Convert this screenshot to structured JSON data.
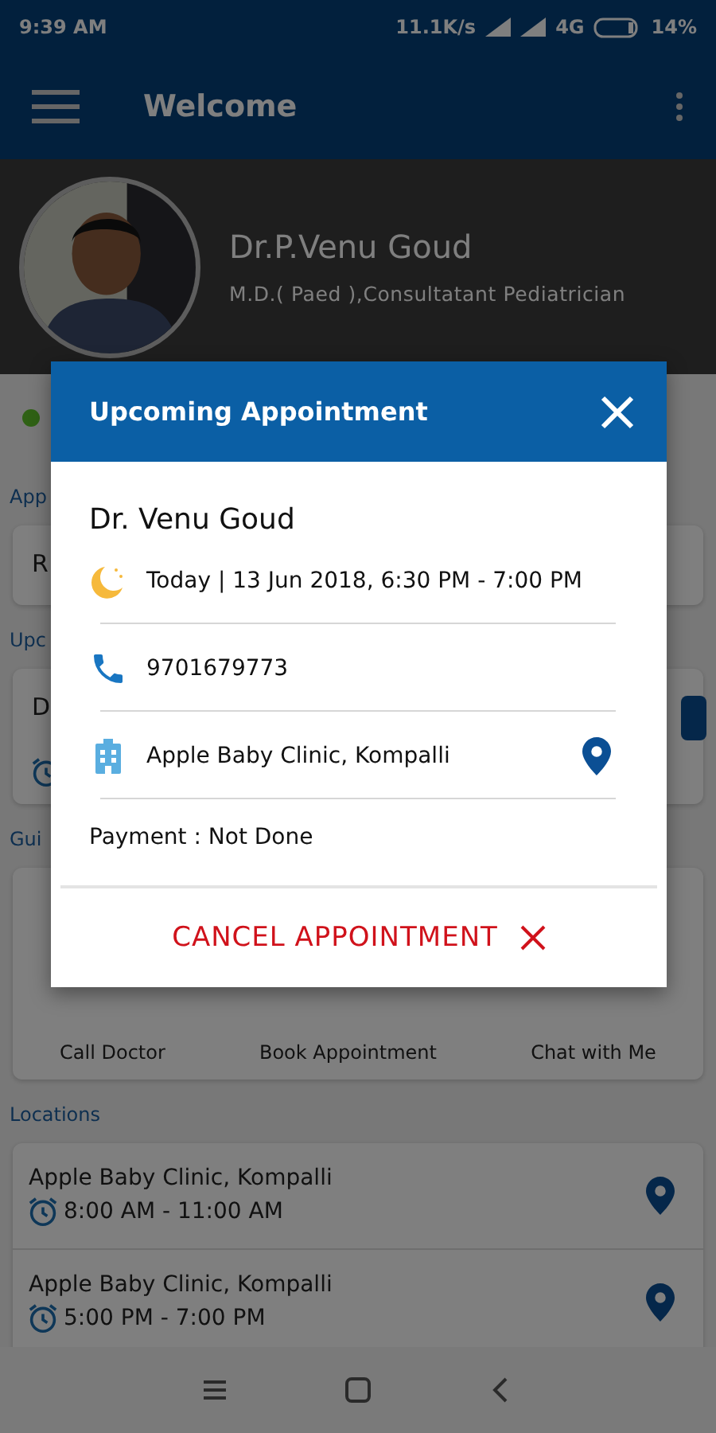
{
  "status_bar": {
    "time": "9:39 AM",
    "speed": "11.1K/s",
    "network": "4G",
    "battery": "14%"
  },
  "app_bar": {
    "title": "Welcome"
  },
  "profile": {
    "name": "Dr.P.Venu Goud",
    "qualification": "M.D.( Paed ),Consultatant Pediatrician"
  },
  "sections": [
    {
      "kind": "text",
      "heading": "App",
      "text": "R"
    },
    {
      "kind": "appointment",
      "heading": "Upc",
      "text": "D"
    },
    {
      "kind": "actions",
      "heading": "Gui",
      "actions": [
        "Call Doctor",
        "Book Appointment",
        "Chat with Me"
      ]
    },
    {
      "kind": "locations",
      "heading": "Locations",
      "locations": [
        {
          "name": "Apple Baby Clinic, Kompalli",
          "hours": "8:00 AM - 11:00 AM"
        },
        {
          "name": "Apple Baby Clinic, Kompalli",
          "hours": "5:00 PM - 7:00 PM"
        }
      ]
    }
  ],
  "dialog": {
    "title": "Upcoming Appointment",
    "doctor": "Dr. Venu Goud",
    "datetime": "Today | 13 Jun 2018, 6:30 PM - 7:00 PM",
    "phone": "9701679773",
    "clinic": "Apple Baby Clinic, Kompalli",
    "payment": "Payment : Not Done",
    "cancel": "CANCEL APPOINTMENT"
  }
}
